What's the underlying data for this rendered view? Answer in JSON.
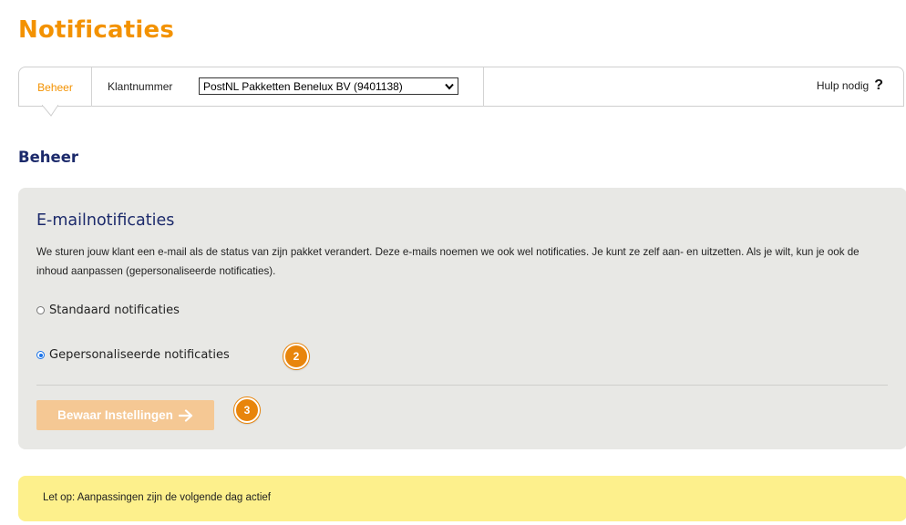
{
  "page": {
    "title": "Notificaties"
  },
  "topbar": {
    "active_tab": "Beheer",
    "klant_label": "Klantnummer",
    "klant_selected": "PostNL Pakketten Benelux BV (9401138)",
    "help_label": "Hulp nodig",
    "help_mark": "?"
  },
  "section": {
    "title": "Beheer"
  },
  "panel": {
    "title": "E-mailnotificaties",
    "description": "We sturen jouw klant een e-mail als de status van zijn pakket verandert. Deze e-mails noemen we ook wel notificaties. Je kunt ze zelf aan- en uitzetten. Als je wilt, kun je ook de inhoud aanpassen (gepersonaliseerde notificaties).",
    "options": [
      {
        "label": "Standaard notificaties",
        "checked": false
      },
      {
        "label": "Gepersonaliseerde notificaties",
        "checked": true
      }
    ],
    "save_label": "Bewaar Instellingen"
  },
  "badges": {
    "step2": "2",
    "step3": "3"
  },
  "notice": {
    "text": "Let op: Aanpassingen zijn de volgende dag actief"
  },
  "colors": {
    "brand_orange": "#f39200",
    "navy": "#1c2a6b",
    "panel_bg": "#e8e8e5",
    "notice_bg": "#fdf08c",
    "button_disabled": "#f5c894",
    "badge": "#e8850c"
  }
}
